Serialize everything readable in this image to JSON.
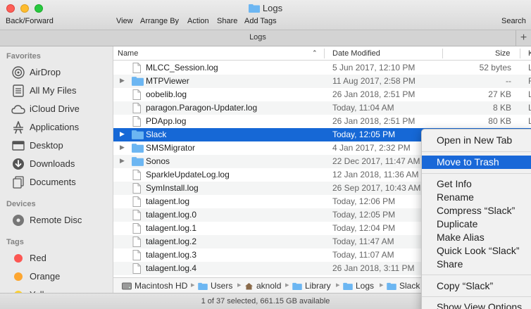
{
  "window": {
    "title": "Logs"
  },
  "toolbar": {
    "back_forward": "Back/Forward",
    "view": "View",
    "arrange_by": "Arrange By",
    "action": "Action",
    "share": "Share",
    "add_tags": "Add Tags",
    "search": "Search"
  },
  "tab": {
    "title": "Logs",
    "plus": "+"
  },
  "sidebar": {
    "favorites_header": "Favorites",
    "favorites": [
      {
        "label": "AirDrop",
        "icon": "airdrop-icon"
      },
      {
        "label": "All My Files",
        "icon": "all-files-icon"
      },
      {
        "label": "iCloud Drive",
        "icon": "cloud-icon"
      },
      {
        "label": "Applications",
        "icon": "applications-icon"
      },
      {
        "label": "Desktop",
        "icon": "desktop-icon"
      },
      {
        "label": "Downloads",
        "icon": "downloads-icon"
      },
      {
        "label": "Documents",
        "icon": "documents-icon"
      }
    ],
    "devices_header": "Devices",
    "devices": [
      {
        "label": "Remote Disc",
        "icon": "disc-icon"
      }
    ],
    "tags_header": "Tags",
    "tags": [
      {
        "label": "Red",
        "color": "#fc5753"
      },
      {
        "label": "Orange",
        "color": "#fda631"
      },
      {
        "label": "Yellow",
        "color": "#fcd032"
      }
    ]
  },
  "columns": {
    "name": "Name",
    "date": "Date Modified",
    "size": "Size",
    "kind": "K"
  },
  "files": [
    {
      "name": "MLCC_Session.log",
      "date": "5 Jun 2017, 12:10 PM",
      "size": "52 bytes",
      "kind": "L",
      "type": "file"
    },
    {
      "name": "MTPViewer",
      "date": "11 Aug 2017, 2:58 PM",
      "size": "--",
      "kind": "F",
      "type": "folder"
    },
    {
      "name": "oobelib.log",
      "date": "26 Jan 2018, 2:51 PM",
      "size": "27 KB",
      "kind": "L",
      "type": "file"
    },
    {
      "name": "paragon.Paragon-Updater.log",
      "date": "Today, 11:04 AM",
      "size": "8 KB",
      "kind": "L",
      "type": "file"
    },
    {
      "name": "PDApp.log",
      "date": "26 Jan 2018, 2:51 PM",
      "size": "80 KB",
      "kind": "L",
      "type": "file"
    },
    {
      "name": "Slack",
      "date": "Today, 12:05 PM",
      "size": "",
      "kind": "",
      "type": "folder",
      "selected": true
    },
    {
      "name": "SMSMigrator",
      "date": "4 Jan 2017, 2:32 PM",
      "size": "",
      "kind": "",
      "type": "folder"
    },
    {
      "name": "Sonos",
      "date": "22 Dec 2017, 11:47 AM",
      "size": "",
      "kind": "",
      "type": "folder"
    },
    {
      "name": "SparkleUpdateLog.log",
      "date": "12 Jan 2018, 11:36 AM",
      "size": "",
      "kind": "",
      "type": "file"
    },
    {
      "name": "SymInstall.log",
      "date": "26 Sep 2017, 10:43 AM",
      "size": "",
      "kind": "",
      "type": "file"
    },
    {
      "name": "talagent.log",
      "date": "Today, 12:06 PM",
      "size": "",
      "kind": "",
      "type": "file"
    },
    {
      "name": "talagent.log.0",
      "date": "Today, 12:05 PM",
      "size": "",
      "kind": "",
      "type": "file"
    },
    {
      "name": "talagent.log.1",
      "date": "Today, 12:04 PM",
      "size": "",
      "kind": "",
      "type": "file"
    },
    {
      "name": "talagent.log.2",
      "date": "Today, 11:47 AM",
      "size": "",
      "kind": "",
      "type": "file"
    },
    {
      "name": "talagent.log.3",
      "date": "Today, 11:07 AM",
      "size": "",
      "kind": "",
      "type": "file"
    },
    {
      "name": "talagent.log.4",
      "date": "26 Jan 2018, 3:11 PM",
      "size": "",
      "kind": "",
      "type": "file"
    }
  ],
  "path": [
    "Macintosh HD",
    "Users",
    "aknold",
    "Library",
    "Logs",
    "Slack"
  ],
  "status": "1 of 37 selected, 661.15 GB available",
  "context_menu": {
    "open_new_tab": "Open in New Tab",
    "move_to_trash": "Move to Trash",
    "get_info": "Get Info",
    "rename": "Rename",
    "compress": "Compress “Slack”",
    "duplicate": "Duplicate",
    "make_alias": "Make Alias",
    "quick_look": "Quick Look “Slack”",
    "share": "Share",
    "copy": "Copy “Slack”",
    "show_view_options": "Show View Options"
  },
  "colors": {
    "selection": "#1668d6",
    "menu_highlight": "#1968d8",
    "folder": "#6cb6f2"
  }
}
